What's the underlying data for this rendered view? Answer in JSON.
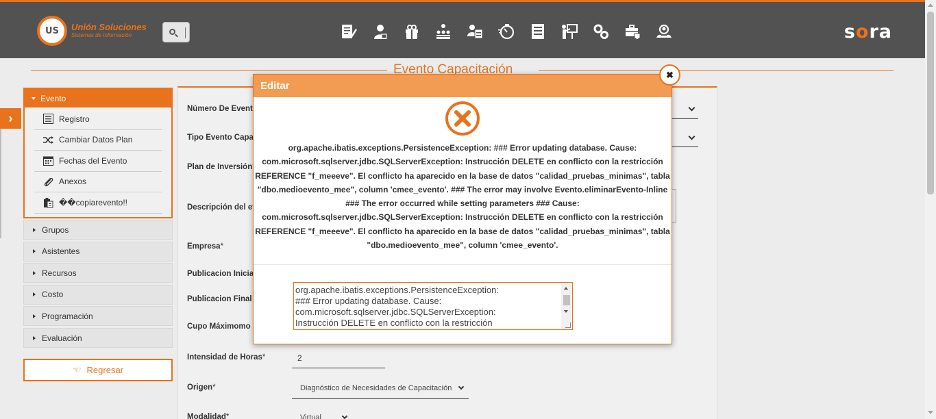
{
  "header": {
    "logo_badge": "US",
    "logo_title": "Unión Soluciones",
    "logo_subtitle": "Sistemas de Información",
    "brand_prefix": "s",
    "brand_o": "o",
    "brand_suffix": "ra",
    "nav_icons": [
      "edit-document-icon",
      "user-icon",
      "gift-icon",
      "hierarchy-icon",
      "user-card-icon",
      "stopwatch-icon",
      "report-icon",
      "presentation-icon",
      "gears-icon",
      "toolbox-icon",
      "group-search-icon"
    ]
  },
  "page": {
    "title": "Evento Capacitación"
  },
  "sidebar": {
    "section_title": "Evento",
    "sub_items": [
      {
        "label": "Registro",
        "icon": "list-icon"
      },
      {
        "label": "Cambiar Datos Plan",
        "icon": "shuffle-icon"
      },
      {
        "label": "Fechas del Evento",
        "icon": "calendar-icon"
      },
      {
        "label": "Anexos",
        "icon": "paperclip-icon"
      },
      {
        "label": "��copiarevento!!",
        "icon": "clipboard-icon"
      }
    ],
    "accordion": [
      "Grupos",
      "Asistentes",
      "Recursos",
      "Costo",
      "Programación",
      "Evaluación"
    ],
    "back_label": "Regresar"
  },
  "form": {
    "numero_evento_label": "Número De Evento",
    "tipo_evento_label": "Tipo Evento Capac",
    "plan_inversion_label": "Plan de Inversión",
    "descripcion_label": "Descripción del ev",
    "empresa_label": "Empresa",
    "publicacion_inicial_label": "Publicacion Inicial",
    "publicacion_final_label": "Publicacion Final",
    "cupo_maximo_label": "Cupo Máximomo",
    "intensidad_label": "Intensidad de Horas",
    "intensidad_value": "2",
    "origen_label": "Origen",
    "origen_value": "Diagnóstico de Necesidades de Capacitación",
    "modalidad_label": "Modalidad",
    "modalidad_value": "Virtual",
    "required_mark": "*"
  },
  "modal": {
    "title": "Editar",
    "close_symbol": "✖",
    "error_message": "org.apache.ibatis.exceptions.PersistenceException: ### Error updating database. Cause: com.microsoft.sqlserver.jdbc.SQLServerException: Instrucción DELETE en conflicto con la restricción REFERENCE \"f_meeeve\". El conflicto ha aparecido en la base de datos \"calidad_pruebas_minimas\", tabla \"dbo.medioevento_mee\", column 'cmee_evento'. ### The error may involve Evento.eliminarEvento-Inline ### The error occurred while setting parameters ### Cause: com.microsoft.sqlserver.jdbc.SQLServerException: Instrucción DELETE en conflicto con la restricción REFERENCE \"f_meeeve\". El conflicto ha aparecido en la base de datos \"calidad_pruebas_minimas\", tabla \"dbo.medioevento_mee\", column 'cmee_evento'.",
    "detail_text": "org.apache.ibatis.exceptions.PersistenceException:\n### Error updating database.  Cause:\ncom.microsoft.sqlserver.jdbc.SQLServerException:\nInstrucción DELETE en conflicto con la restricción"
  },
  "colors": {
    "accent": "#e8731c",
    "header_bg": "#525252",
    "modal_head": "#f29b52"
  }
}
